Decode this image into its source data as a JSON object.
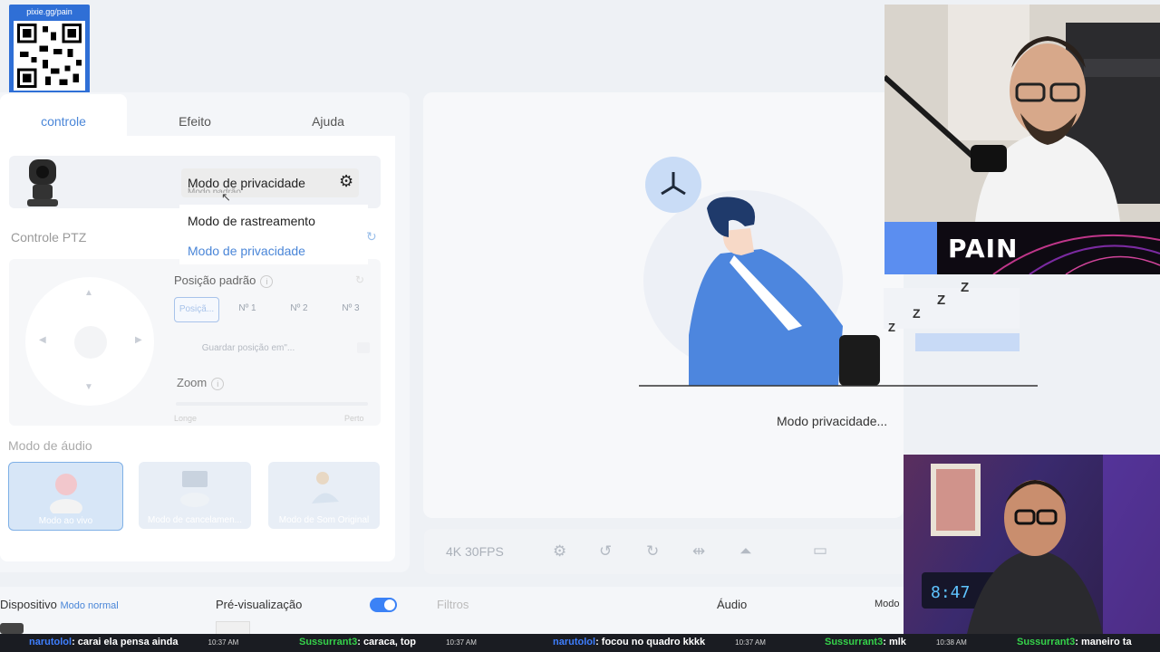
{
  "overlay": {
    "qr_url": "pixie.gg/pain"
  },
  "tabs": [
    {
      "label": "controle",
      "active": true
    },
    {
      "label": "Efeito",
      "active": false
    },
    {
      "label": "Ajuda",
      "active": false
    }
  ],
  "dropdown": {
    "selected": "Modo de privacidade",
    "hidden_label": "Modo padrão",
    "options": [
      {
        "label": "Modo de rastreamento",
        "highlighted": false
      },
      {
        "label": "Modo de privacidade",
        "highlighted": true
      }
    ]
  },
  "ptz": {
    "label": "Controle PTZ",
    "position_label": "Posição padrão",
    "position_buttons": [
      "Posiçã...",
      "Nº 1",
      "Nº 2",
      "Nº 3"
    ],
    "save_position": "Guardar posição em\"...",
    "zoom_label": "Zoom",
    "zoom_min": "Longe",
    "zoom_max": "Perto"
  },
  "audio": {
    "label": "Modo de áudio",
    "modes": [
      "Modo ao vivo",
      "Modo de cancelamen...",
      "Modo de Som Original"
    ]
  },
  "preview": {
    "status": "Modo privacidade..."
  },
  "toolbar": {
    "resolution": "4K 30FPS"
  },
  "bottom": {
    "device_label": "Dispositivo",
    "device_mode": "Modo normal",
    "preview_label": "Pré-visualização",
    "filters_label": "Filtros",
    "audio_label": "Áudio",
    "mode_label": "Modo"
  },
  "webcam": {
    "brand": "PAIN"
  },
  "chat": [
    {
      "user": "narutolol",
      "msg": "carai ela pensa ainda",
      "time": "10:37 AM"
    },
    {
      "user": "Sussurrant3",
      "msg": "caraca, top",
      "time": "10:37 AM"
    },
    {
      "user": "narutolol",
      "msg": "focou no quadro kkkk",
      "time": "10:37 AM"
    },
    {
      "user": "Sussurrant3",
      "msg": "mlk",
      "time": "10:38 AM"
    },
    {
      "user": "Sussurrant3",
      "msg": "maneiro ta",
      "time": ""
    }
  ],
  "colors": {
    "accent": "#4a86d8",
    "toggle": "#3b82f6",
    "preview_bg": "#f7f8fa"
  }
}
